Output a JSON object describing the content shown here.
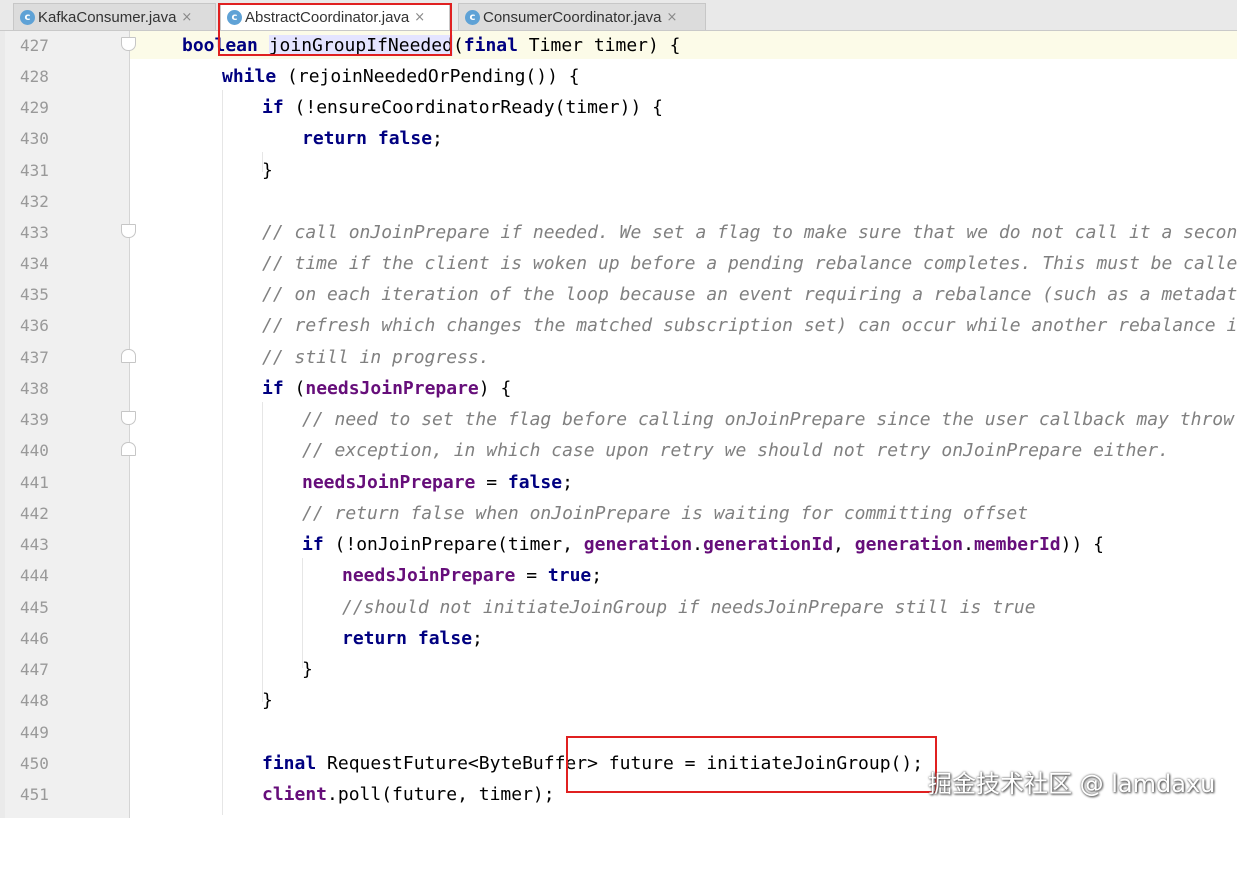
{
  "tabs": [
    {
      "label": "KafkaConsumer.java",
      "icon": "java-class-icon",
      "icon_glyph": "c",
      "active": false
    },
    {
      "label": "AbstractCoordinator.java",
      "icon": "java-class-icon",
      "icon_glyph": "c",
      "active": true
    },
    {
      "label": "ConsumerCoordinator.java",
      "icon": "java-class-icon",
      "icon_glyph": "c",
      "active": false
    }
  ],
  "close_glyph": "×",
  "editor": {
    "lines": [
      {
        "n": "427",
        "indent": 0
      },
      {
        "n": "428",
        "indent": 1
      },
      {
        "n": "429",
        "indent": 2
      },
      {
        "n": "430",
        "indent": 3
      },
      {
        "n": "431",
        "indent": 2
      },
      {
        "n": "432",
        "indent": 2
      },
      {
        "n": "433",
        "indent": 2
      },
      {
        "n": "434",
        "indent": 2
      },
      {
        "n": "435",
        "indent": 2
      },
      {
        "n": "436",
        "indent": 2
      },
      {
        "n": "437",
        "indent": 2
      },
      {
        "n": "438",
        "indent": 2
      },
      {
        "n": "439",
        "indent": 3
      },
      {
        "n": "440",
        "indent": 3
      },
      {
        "n": "441",
        "indent": 3
      },
      {
        "n": "442",
        "indent": 3
      },
      {
        "n": "443",
        "indent": 3
      },
      {
        "n": "444",
        "indent": 4
      },
      {
        "n": "445",
        "indent": 4
      },
      {
        "n": "446",
        "indent": 4
      },
      {
        "n": "447",
        "indent": 3
      },
      {
        "n": "448",
        "indent": 2
      },
      {
        "n": "449",
        "indent": 2
      },
      {
        "n": "450",
        "indent": 2
      },
      {
        "n": "451",
        "indent": 2
      }
    ],
    "code": {
      "l427_a": "boolean",
      "l427_b": "joinGroupIfNeeded",
      "l427_c": "(",
      "l427_d": "final",
      "l427_e": " Timer timer) {",
      "l428_a": "while",
      "l428_b": " (rejoinNeededOrPending()) {",
      "l429_a": "if",
      "l429_b": " (!ensureCoordinatorReady(timer)) {",
      "l430_a": "return false",
      "l430_b": ";",
      "l431": "}",
      "l433": "// call onJoinPrepare if needed. We set a flag to make sure that we do not call it a second",
      "l434": "// time if the client is woken up before a pending rebalance completes. This must be called",
      "l435": "// on each iteration of the loop because an event requiring a rebalance (such as a metadata",
      "l436": "// refresh which changes the matched subscription set) can occur while another rebalance is",
      "l437": "// still in progress.",
      "l438_a": "if",
      "l438_b": " (",
      "l438_c": "needsJoinPrepare",
      "l438_d": ") {",
      "l439": "// need to set the flag before calling onJoinPrepare since the user callback may throw",
      "l440": "// exception, in which case upon retry we should not retry onJoinPrepare either.",
      "l441_a": "needsJoinPrepare",
      "l441_b": " = ",
      "l441_c": "false",
      "l441_d": ";",
      "l442": "// return false when onJoinPrepare is waiting for committing offset",
      "l443_a": "if",
      "l443_b": " (!onJoinPrepare(timer, ",
      "l443_c": "generation",
      "l443_d": ".",
      "l443_e": "generationId",
      "l443_f": ", ",
      "l443_g": "generation",
      "l443_h": ".",
      "l443_i": "memberId",
      "l443_j": ")) {",
      "l444_a": "needsJoinPrepare",
      "l444_b": " = ",
      "l444_c": "true",
      "l444_d": ";",
      "l445": "//should not initiateJoinGroup if needsJoinPrepare still is true",
      "l446_a": "return false",
      "l446_b": ";",
      "l447": "}",
      "l448": "}",
      "l450_a": "final",
      "l450_b": " RequestFuture<ByteBuffer> future = initiateJoinGroup();",
      "l451_a": "client",
      "l451_b": ".poll(future, timer);"
    }
  },
  "watermark": "掘金技术社区 @ lamdaxu",
  "colors": {
    "keyword": "#000080",
    "field": "#660e7a",
    "comment": "#808080",
    "line_number": "#999999",
    "highlight_box": "#e02020"
  }
}
